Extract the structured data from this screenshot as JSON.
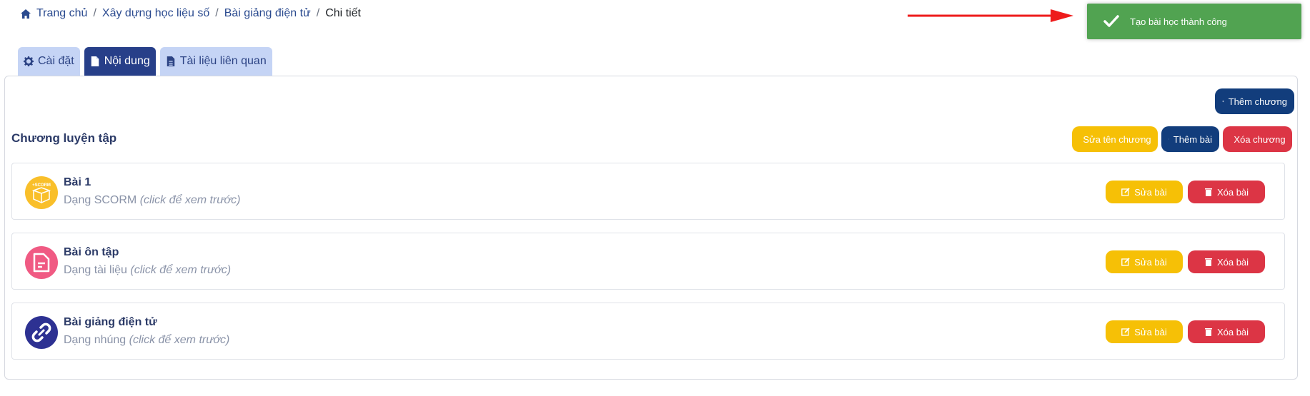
{
  "breadcrumb": {
    "home": "Trang chủ",
    "items": [
      "Xây dựng học liệu số",
      "Bài giảng điện tử"
    ],
    "current": "Chi tiết",
    "separator": "/"
  },
  "toast": {
    "message": "Tạo bài học thành công",
    "color": "#51a351"
  },
  "tabs": [
    {
      "label": "Cài đặt",
      "icon": "gear-icon",
      "active": false
    },
    {
      "label": "Nội dung",
      "icon": "file-icon",
      "active": true
    },
    {
      "label": "Tài liệu liên quan",
      "icon": "file-text-icon",
      "active": false
    }
  ],
  "toolbar": {
    "add_chapter": "Thêm chương"
  },
  "chapter": {
    "title": "Chương luyện tập",
    "rename": "Sửa tên chương",
    "add_lesson": "Thêm bài",
    "delete": "Xóa chương"
  },
  "lessons": [
    {
      "title": "Bài 1",
      "type": "Dạng SCORM",
      "hint": "(click để xem trước)",
      "icon": "scorm-icon",
      "edit": "Sửa bài",
      "delete": "Xóa bài"
    },
    {
      "title": "Bài ôn tập",
      "type": "Dạng tài liệu",
      "hint": "(click để xem trước)",
      "icon": "document-icon",
      "edit": "Sửa bài",
      "delete": "Xóa bài"
    },
    {
      "title": "Bài giảng điện tử",
      "type": "Dạng nhúng",
      "hint": "(click để xem trước)",
      "icon": "link-icon",
      "edit": "Sửa bài",
      "delete": "Xóa bài"
    }
  ],
  "colors": {
    "navy": "#123d7c",
    "yellow": "#f6c006",
    "red": "#dc3545",
    "tab_active": "#273f89",
    "tab_inactive": "#c5d4f5"
  }
}
